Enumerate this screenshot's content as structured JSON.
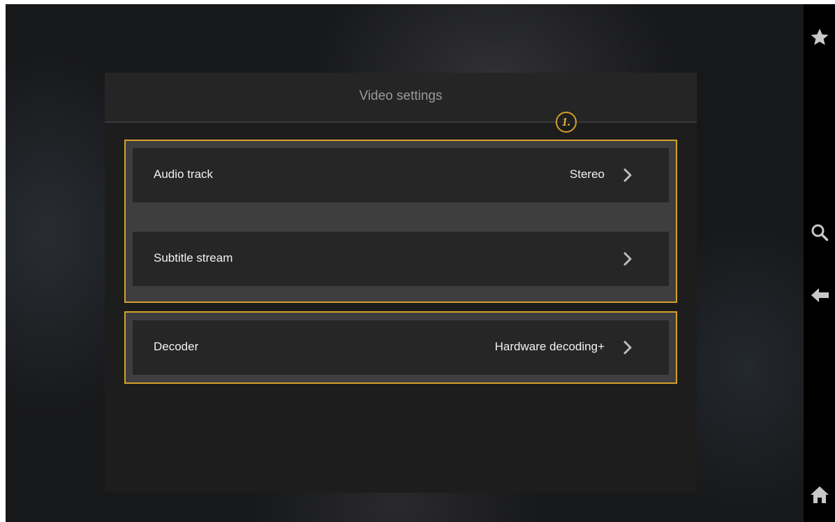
{
  "dialog": {
    "title": "Video settings",
    "callout_number": "1.",
    "items": [
      {
        "label": "Audio track",
        "value": "Stereo"
      },
      {
        "label": "Subtitle stream",
        "value": ""
      },
      {
        "label": "Decoder",
        "value": "Hardware decoding+"
      }
    ]
  },
  "nav": {
    "icons": [
      "star-icon",
      "search-icon",
      "back-arrow-icon",
      "home-icon"
    ]
  },
  "colors": {
    "highlight": "#d4a12a",
    "dialog_bg": "#1d1d1d",
    "row_bg": "#262626",
    "nav_bg": "#000000"
  }
}
